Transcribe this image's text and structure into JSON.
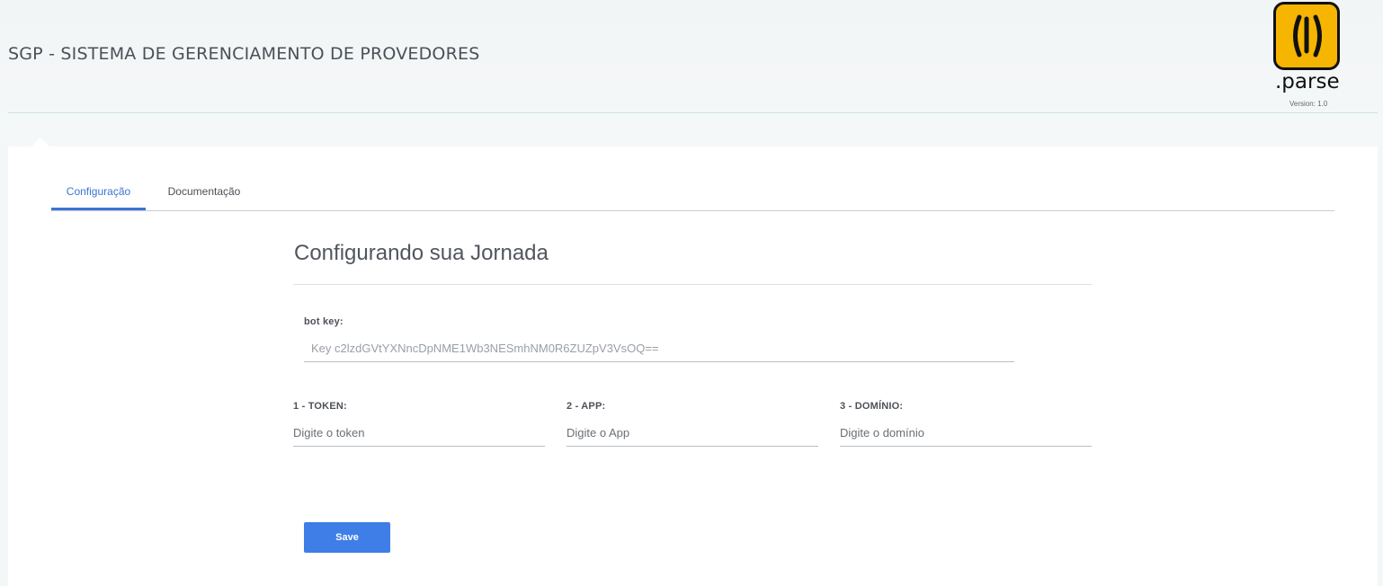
{
  "header": {
    "title": "SGP - SISTEMA DE GERENCIAMENTO DE PROVEDORES",
    "logo_text": ".parse",
    "version": "Version: 1.0"
  },
  "tabs": [
    {
      "label": "Configuração",
      "active": true
    },
    {
      "label": "Documentação",
      "active": false
    }
  ],
  "form": {
    "title": "Configurando sua Jornada",
    "bot_key": {
      "label": "bot key:",
      "placeholder": "Key c2lzdGVtYXNncDpNME1Wb3NESmhNM0R6ZUZpV3VsOQ=="
    },
    "token": {
      "label": "1 - TOKEN:",
      "placeholder": "Digite o token"
    },
    "app": {
      "label": "2 - APP:",
      "placeholder": "Digite o App"
    },
    "domain": {
      "label": "3 - DOMÍNIO:",
      "placeholder": "Digite o domínio"
    },
    "save_label": "Save"
  },
  "colors": {
    "accent": "#3b74d6",
    "button": "#3f7ee6",
    "logo_yellow": "#f6b500"
  }
}
